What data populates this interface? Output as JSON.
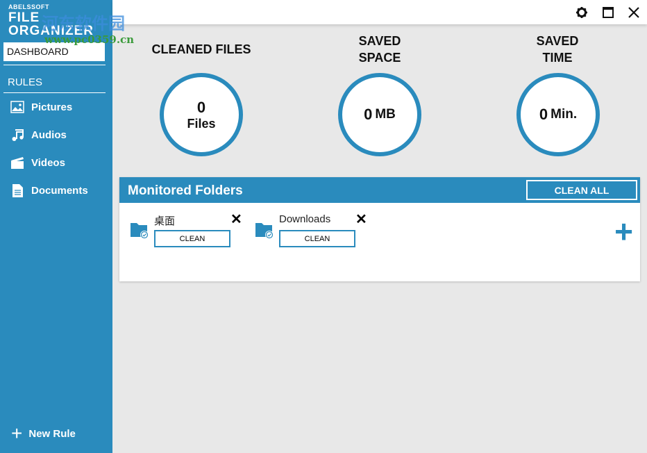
{
  "logo": {
    "brand": "ABELSSOFT",
    "product": "FILE ORGANIZER"
  },
  "watermark": {
    "line1": "河东软件园",
    "line2": "www.pc0359.cn"
  },
  "sidebar": {
    "dashboard": "DASHBOARD",
    "rules_header": "RULES",
    "items": [
      {
        "label": "Pictures",
        "icon": "image-icon"
      },
      {
        "label": "Audios",
        "icon": "music-note-icon"
      },
      {
        "label": "Videos",
        "icon": "clapperboard-icon"
      },
      {
        "label": "Documents",
        "icon": "document-icon"
      }
    ],
    "new_rule": "New Rule"
  },
  "stats": [
    {
      "title": "CLEANED FILES",
      "value": "0",
      "unit": "Files"
    },
    {
      "title": "SAVED SPACE",
      "value": "0",
      "unit": "MB"
    },
    {
      "title": "SAVED TIME",
      "value": "0",
      "unit": "Min."
    }
  ],
  "stats_titles": {
    "saved_space_1": "SAVED",
    "saved_space_2": "SPACE",
    "saved_time_1": "SAVED",
    "saved_time_2": "TIME"
  },
  "monitored": {
    "title": "Monitored Folders",
    "clean_all": "CLEAN ALL",
    "folders": [
      {
        "name": "桌面",
        "clean": "CLEAN"
      },
      {
        "name": "Downloads",
        "clean": "CLEAN"
      }
    ]
  },
  "colors": {
    "accent": "#2a8bbd"
  }
}
